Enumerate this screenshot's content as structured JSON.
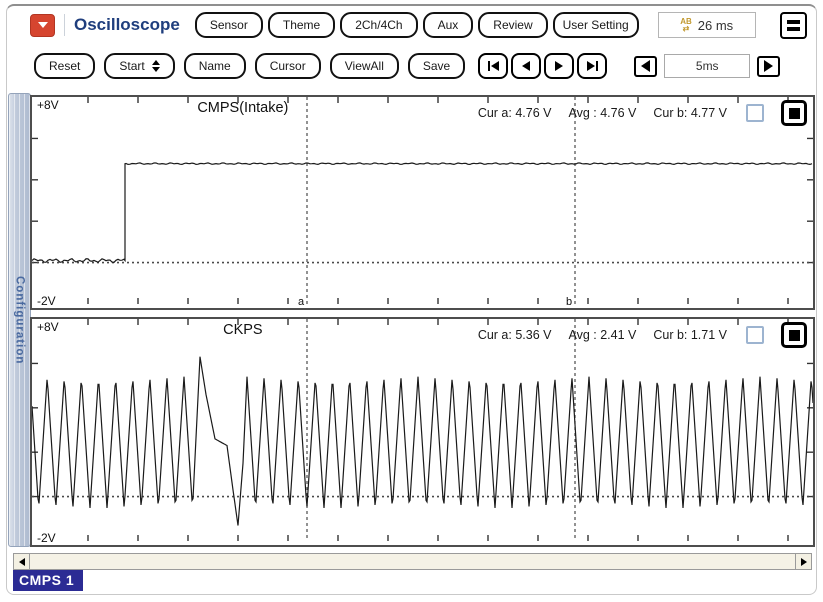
{
  "header": {
    "title": "Oscilloscope",
    "ab_time": "26 ms",
    "buttons": [
      "Sensor",
      "Theme",
      "2Ch/4Ch",
      "Aux",
      "Review",
      "User Setting"
    ]
  },
  "toolbar_second": {
    "buttons": [
      "Reset",
      "Start",
      "Name",
      "Cursor",
      "ViewAll",
      "Save"
    ],
    "timebase_value": "5ms"
  },
  "sidebar": {
    "tab_label": "Configuration"
  },
  "channels": [
    {
      "name": "CMPS(Intake)",
      "vmax_label": "+8V",
      "vmin_label": "-2V",
      "cur_a": "Cur a: 4.76 V",
      "avg": "Avg : 4.76 V",
      "cur_b": "Cur b: 4.77 V",
      "cursor_a_label": "a",
      "cursor_b_label": "b"
    },
    {
      "name": "CKPS",
      "vmax_label": "+8V",
      "vmin_label": "-2V",
      "cur_a": "Cur a: 5.36 V",
      "avg": "Avg : 2.41 V",
      "cur_b": "Cur b: 1.71 V"
    }
  ],
  "bottom": {
    "channel_tag": "CMPS 1"
  },
  "chart_data": [
    {
      "type": "line",
      "title": "CMPS(Intake)",
      "ylim": [
        -2,
        8
      ],
      "ylabel_top": "+8V",
      "ylabel_bottom": "-2V",
      "time_per_div_ms": 5,
      "x_range_ms": [
        0,
        78
      ],
      "grid": false,
      "zero_reference_line_v": 0,
      "cursors_ms": {
        "a": 27.5,
        "b": 54.3,
        "delta_label": "26 ms"
      },
      "measurements": {
        "cur_a_v": 4.76,
        "avg_v": 4.76,
        "cur_b_v": 4.77
      },
      "waveform": {
        "kind": "step",
        "low_v": 0.1,
        "high_v": 4.78,
        "step_ms": 9.3,
        "low_noise_v": 0.1,
        "high_noise_v": 0.04
      }
    },
    {
      "type": "line",
      "title": "CKPS",
      "ylim": [
        -2,
        8
      ],
      "ylabel_top": "+8V",
      "ylabel_bottom": "-2V",
      "time_per_div_ms": 5,
      "x_range_ms": [
        0,
        78
      ],
      "grid": false,
      "zero_reference_line_v": 0,
      "cursors_ms": {
        "a": 27.5,
        "b": 54.3
      },
      "measurements": {
        "cur_a_v": 5.36,
        "avg_v": 2.41,
        "cur_b_v": 1.71
      },
      "waveform": {
        "kind": "ckps",
        "period_ms": 1.71,
        "min_v": -0.55,
        "max_v": 5.4,
        "last_normal_peak_ms": 15.2,
        "resume_peak_ms": 21.5,
        "tooth_points_ms_v": [
          [
            16.05,
            -0.55
          ],
          [
            16.8,
            6.3
          ],
          [
            17.4,
            4.6
          ],
          [
            18.3,
            2.6
          ],
          [
            19.5,
            2.3
          ],
          [
            20.1,
            0.3
          ],
          [
            20.6,
            -1.3
          ],
          [
            21.1,
            1.5
          ],
          [
            21.5,
            5.4
          ]
        ]
      }
    }
  ]
}
